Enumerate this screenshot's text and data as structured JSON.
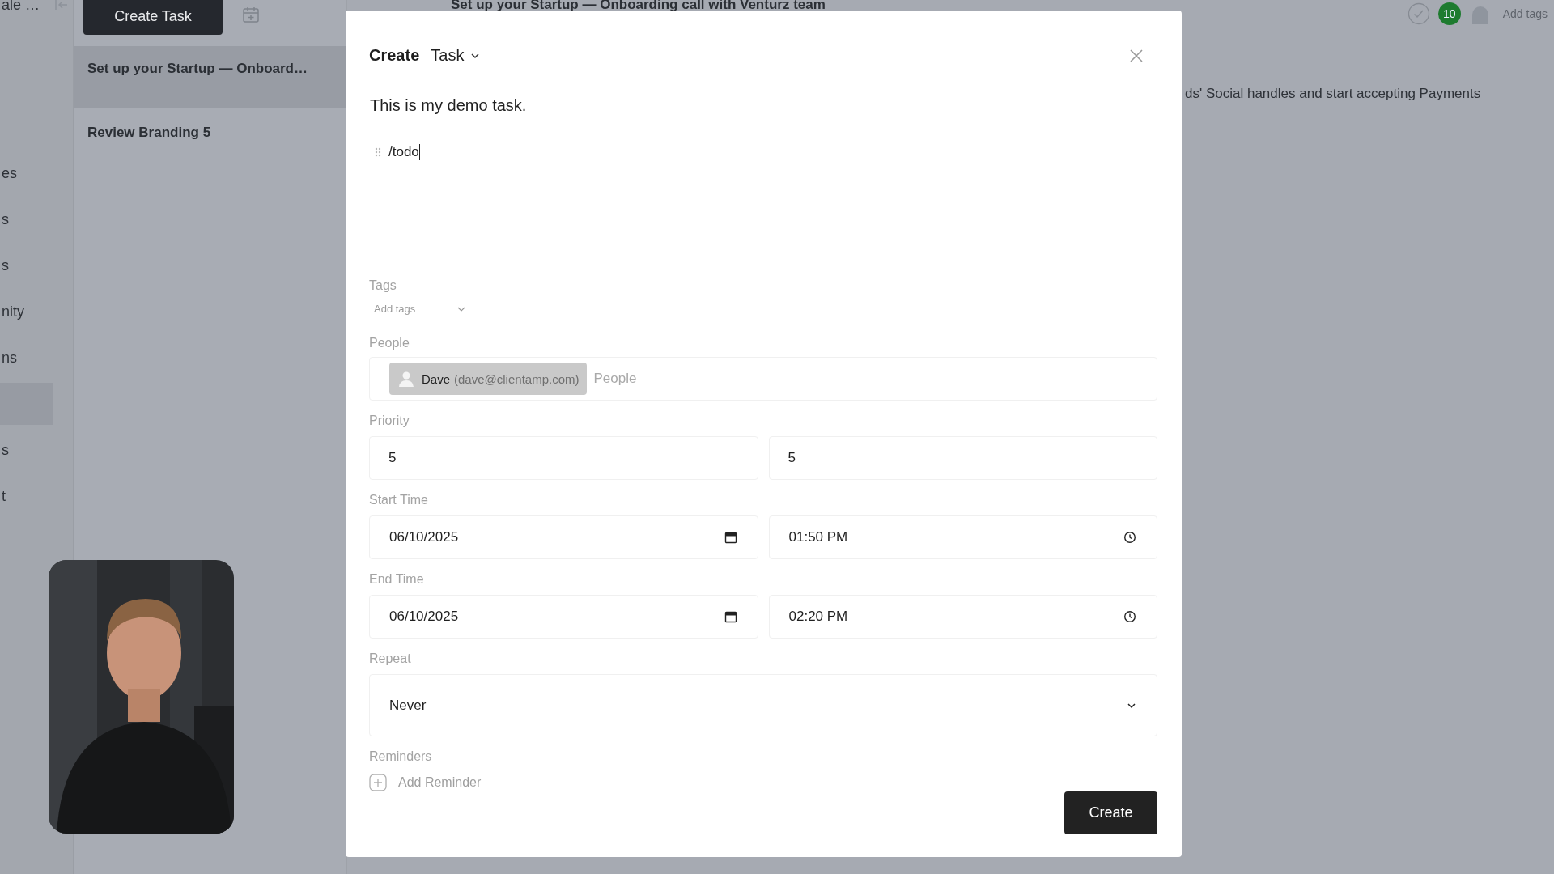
{
  "sidebar": {
    "items": [
      {
        "label": "ale …",
        "selected": false
      },
      {
        "label": "es",
        "selected": false
      },
      {
        "label": "s",
        "selected": false
      },
      {
        "label": "s",
        "selected": false
      },
      {
        "label": "nity",
        "selected": false
      },
      {
        "label": "ns",
        "selected": false
      },
      {
        "selected": true
      },
      {
        "label": "s",
        "selected": false
      },
      {
        "label": "t",
        "selected": false
      }
    ]
  },
  "task_list": {
    "create_button": "Create Task",
    "tasks": [
      {
        "title": "Set up your Startup — Onboard…",
        "selected": true
      },
      {
        "title": "Review Branding 5",
        "selected": false
      }
    ]
  },
  "task_detail": {
    "title": "Set up your Startup — Onboarding call with Venturz team",
    "badge": "10",
    "tags_placeholder": "Add tags",
    "description": "ds' Social handles and start accepting Payments"
  },
  "dialog": {
    "title": "Create",
    "type": "Task",
    "body": "This is my demo task.",
    "editor_line": "/todo",
    "tags": {
      "label": "Tags",
      "placeholder": "Add tags"
    },
    "people": {
      "label": "People",
      "chips": [
        {
          "name": "Dave",
          "email": "(dave@clientamp.com)"
        }
      ],
      "placeholder": "People"
    },
    "priority": {
      "label": "Priority",
      "values": [
        "5",
        "5"
      ]
    },
    "start_time": {
      "label": "Start Time",
      "date": "06/10/2025",
      "time": "01:50 PM"
    },
    "end_time": {
      "label": "End Time",
      "date": "06/10/2025",
      "time": "02:20 PM"
    },
    "repeat": {
      "label": "Repeat",
      "value": "Never"
    },
    "reminders": {
      "label": "Reminders",
      "add": "Add Reminder"
    },
    "submit": "Create"
  }
}
